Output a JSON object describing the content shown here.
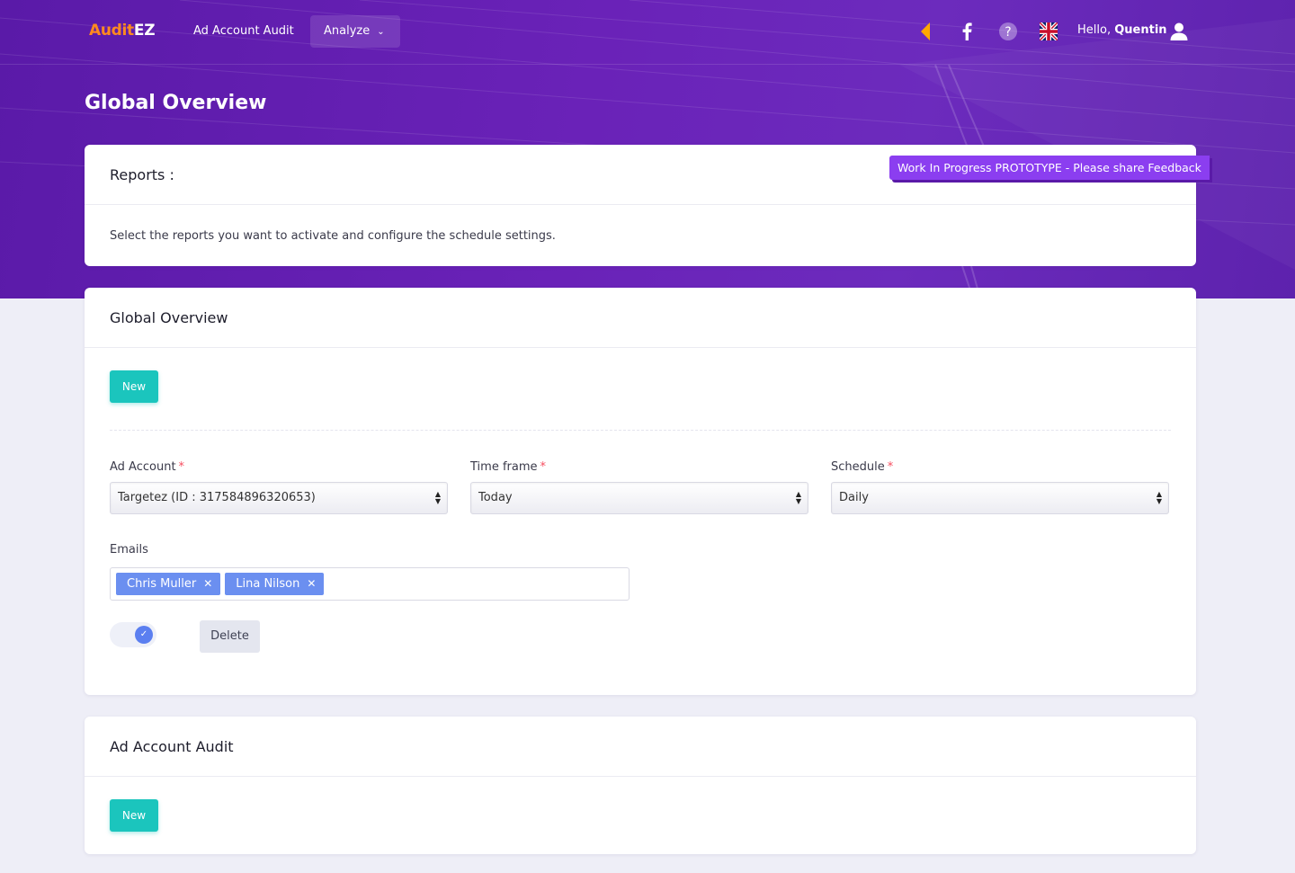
{
  "brand": {
    "part1": "Audit",
    "part2": "EZ"
  },
  "nav": {
    "audit_label": "Ad Account Audit",
    "analyze_label": "Analyze"
  },
  "header_icons": [
    "back-arrow-icon",
    "facebook-icon",
    "help-icon",
    "uk-flag-icon",
    "user-icon"
  ],
  "user": {
    "greeting": "Hello,",
    "name": "Quentin"
  },
  "page": {
    "title": "Global Overview"
  },
  "wip_banner": "Work In Progress PROTOTYPE - Please share Feedback",
  "reports_card": {
    "title": "Reports :",
    "description": "Select the reports you want to activate and configure the schedule settings."
  },
  "global_card": {
    "title": "Global Overview",
    "new_label": "New",
    "ad_account": {
      "label": "Ad Account",
      "required": "*",
      "value": "Targetez (ID : 317584896320653)"
    },
    "time_frame": {
      "label": "Time frame",
      "required": "*",
      "value": "Today"
    },
    "schedule": {
      "label": "Schedule",
      "required": "*",
      "value": "Daily"
    },
    "emails_label": "Emails",
    "emails": [
      "Chris Muller",
      "Lina Nilson"
    ],
    "toggle_on": true,
    "delete_label": "Delete"
  },
  "audit_card": {
    "title": "Ad Account Audit",
    "new_label": "New"
  },
  "colors": {
    "hero": "#6a22b8",
    "brand_accent": "#ff8a1f",
    "success": "#1bc5bd",
    "tag": "#6b8ff0",
    "wip": "#8b3ef0"
  }
}
